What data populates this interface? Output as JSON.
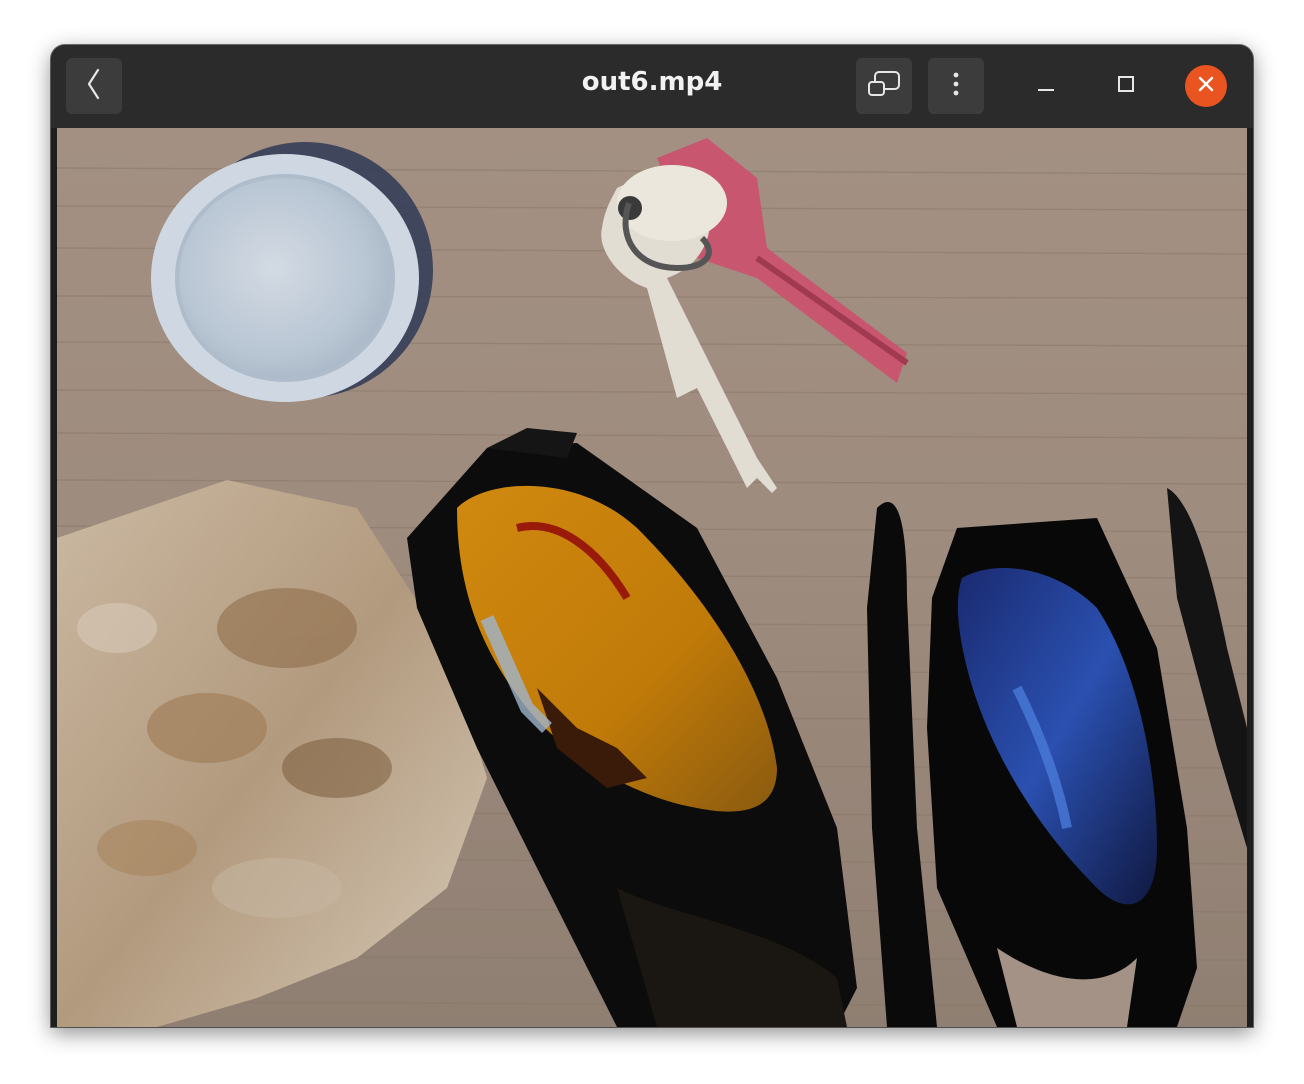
{
  "window": {
    "title": "out6.mp4"
  },
  "headerbar": {
    "back_icon": "chevron-left-icon",
    "pip_icon": "picture-in-picture-icon",
    "menu_icon": "vertical-dots-menu-icon",
    "minimize_icon": "minimize-icon",
    "maximize_icon": "maximize-icon",
    "close_icon": "close-icon"
  },
  "colors": {
    "headerbar": "#2b2b2b",
    "button": "#3c3c3c",
    "close_accent": "#e95420",
    "title_text": "#f2f2f2"
  }
}
